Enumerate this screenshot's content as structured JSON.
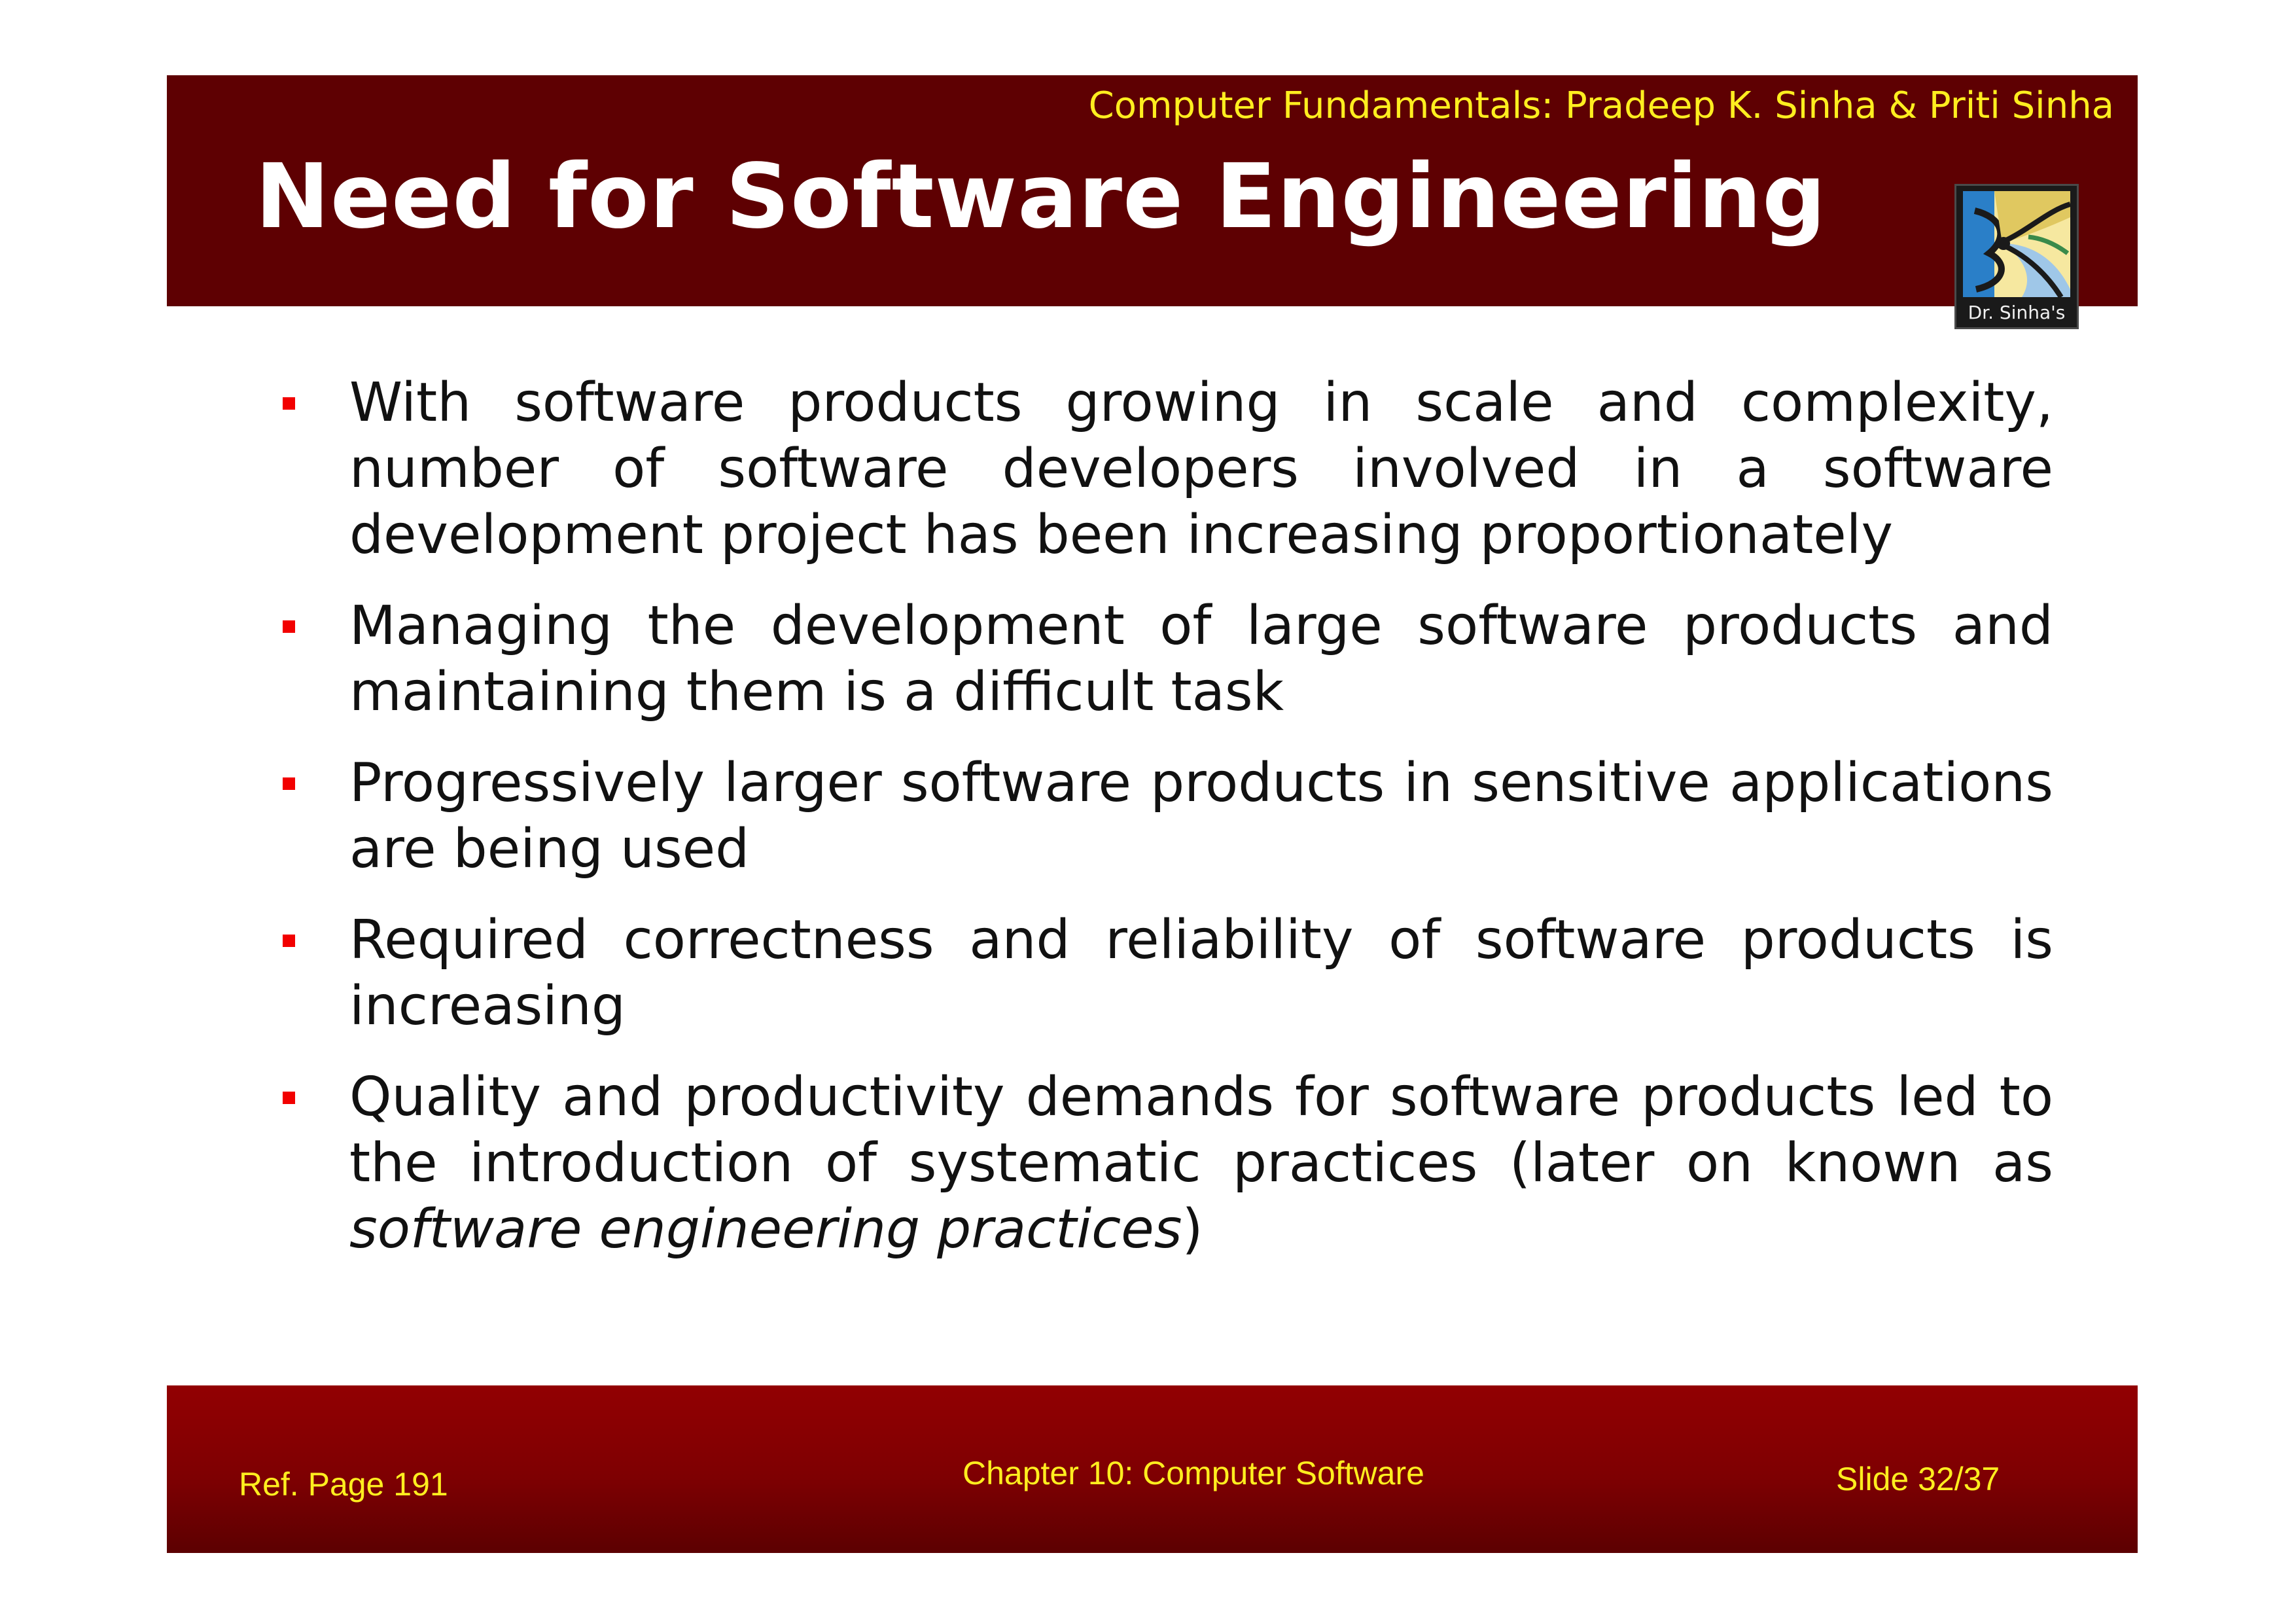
{
  "header": {
    "book_title": "Computer Fundamentals: Pradeep K. Sinha & Priti Sinha",
    "slide_title": "Need for Software Engineering",
    "logo_caption": "Dr. Sinha's",
    "colors": {
      "background": "#5e0002",
      "book_title": "#ffee1f",
      "title": "#ffffff"
    }
  },
  "bullets": [
    {
      "text": "With software products growing in scale and complexity, number of software developers involved in a software development project has been increasing proportionately"
    },
    {
      "text": "Managing the development of large software products and maintaining them is a difficult task"
    },
    {
      "text": "Progressively larger software products in sensitive applications are being used"
    },
    {
      "text": "Required correctness and reliability of software products is increasing"
    },
    {
      "text": "Quality and productivity demands for software products led to the introduction of systematic practices (later on known as ",
      "italic": "software engineering practices",
      "after": ")"
    }
  ],
  "footer": {
    "ref_page": "Ref. Page 191",
    "chapter": "Chapter 10: Computer Software",
    "slide_number": "Slide 32/37",
    "colors": {
      "background": "#8a0002",
      "text": "#ffee1f"
    }
  },
  "bullet_marker_color": "#f20000"
}
